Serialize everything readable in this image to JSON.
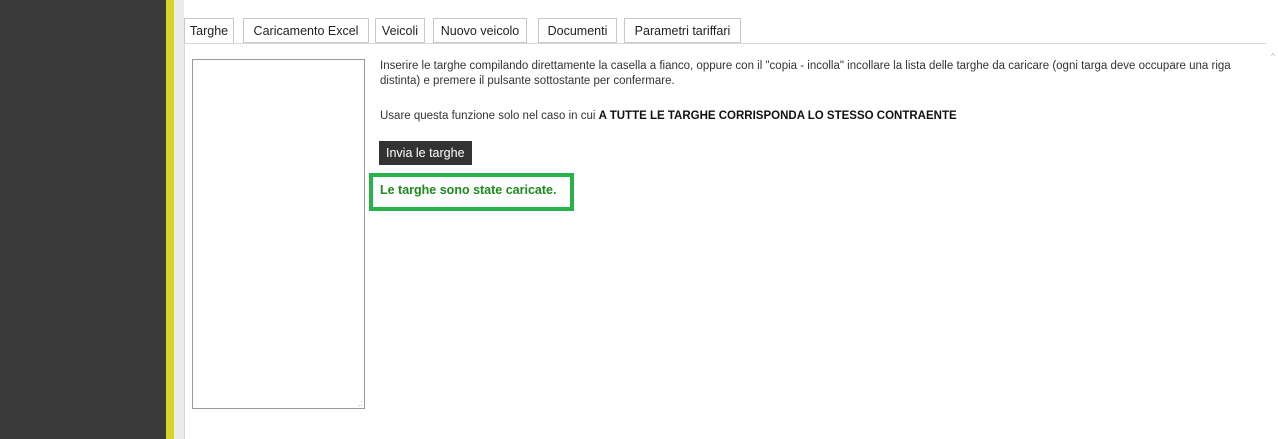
{
  "tabs": [
    {
      "label": "Targhe"
    },
    {
      "label": "Caricamento Excel"
    },
    {
      "label": "Veicoli"
    },
    {
      "label": "Nuovo veicolo"
    },
    {
      "label": "Documenti"
    },
    {
      "label": "Parametri tariffari"
    }
  ],
  "plates_input": {
    "value": "",
    "placeholder": ""
  },
  "instructions": "Inserire le targhe compilando direttamente la casella a fianco, oppure con il \"copia - incolla\" incollare la lista delle targhe da caricare  (ogni targa deve occupare una riga distinta) e premere il pulsante sottostante per confermare.",
  "warning": {
    "prefix": "Usare questa funzione solo nel caso in cui ",
    "emphasis": "A TUTTE LE TARGHE CORRISPONDA LO STESSO CONTRAENTE"
  },
  "send_button": "Invia le targhe",
  "success_message": "Le targhe sono state caricate.",
  "icons": {
    "resize_grip": ".:",
    "scroll_up": "^"
  },
  "colors": {
    "sidebar": "#3a3a3a",
    "accent": "#d6d62a",
    "button": "#333333",
    "success_text": "#1d8a1d",
    "success_border": "#27b34a"
  }
}
